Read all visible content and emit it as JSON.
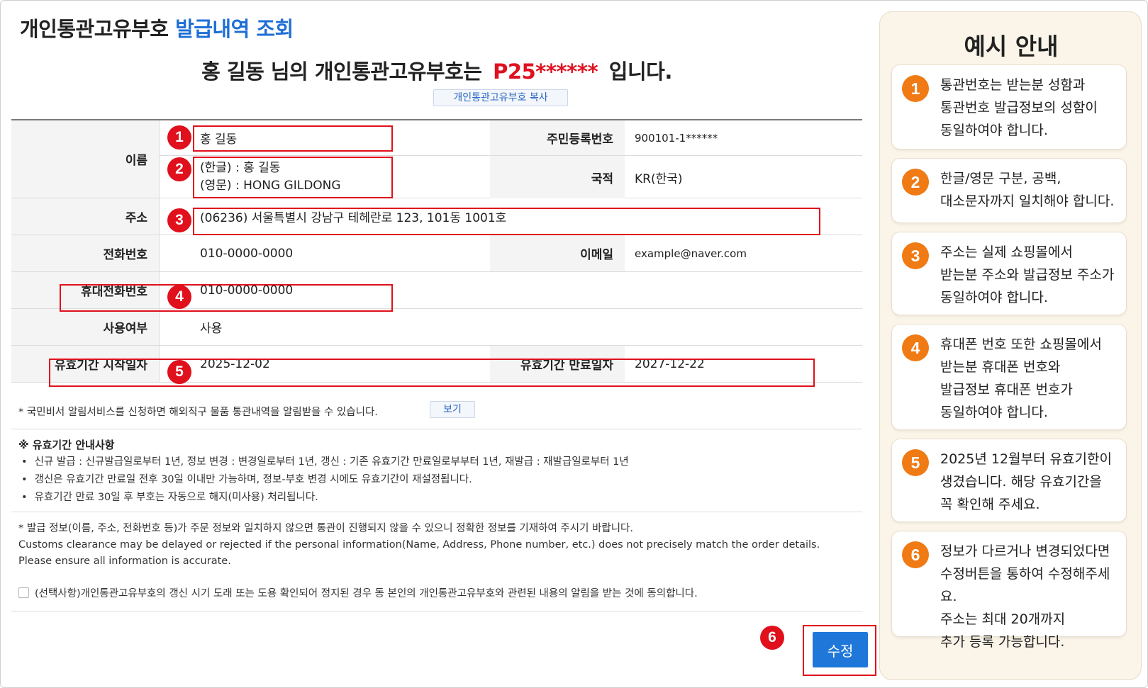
{
  "header": {
    "title_main": "개인통관고유부호",
    "title_accent": "발급내역 조회",
    "headline_prefix": "홍 길동 님의 개인통관고유부호는",
    "headline_number": "P25******",
    "headline_suffix": "입니다.",
    "copy_button": "개인통관고유부호 복사"
  },
  "table": {
    "name_label": "이름",
    "name_value": "홍 길동",
    "name_kr": "(한글) : 홍 길동",
    "name_en": "(영문) : HONG GILDONG",
    "rrn_label": "주민등록번호",
    "rrn_value": "900101-1******",
    "nationality_label": "국적",
    "nationality_value": "KR(한국)",
    "address_label": "주소",
    "address_value": "(06236) 서울특별시 강남구 테헤란로 123, 101동 1001호",
    "phone_label": "전화번호",
    "phone_value": "010-0000-0000",
    "email_label": "이메일",
    "email_value": "example@naver.com",
    "mobile_label": "휴대전화번호",
    "mobile_value": "010-0000-0000",
    "usage_label": "사용여부",
    "usage_value": "사용",
    "start_label": "유효기간 시작일자",
    "start_value": "2025-12-02",
    "end_label": "유효기간 만료일자",
    "end_value": "2027-12-22"
  },
  "badges": [
    "1",
    "2",
    "3",
    "4",
    "5",
    "6"
  ],
  "notice": {
    "alert_text": "* 국민비서 알림서비스를 신청하면 해외직구 물품 통관내역을 알림받을 수 있습니다.",
    "view_button": "보기",
    "guide_title": "※ 유효기간 안내사항",
    "guide_items": [
      "신규 발급 : 신규발급일로부터 1년, 정보 변경 : 변경일로부터 1년, 갱신 : 기존 유효기간 만료일로부부터 1년, 재발급 : 재발급일로부터 1년",
      "갱신은 유효기간 만료일 전후 30일 이내만 가능하며, 정보-부호 변경 시에도 유효기간이 재설정됩니다.",
      "유효기간 만료 30일 후 부호는 자동으로 해지(미사용) 처리됩니다."
    ],
    "warn_kr": "* 발급 정보(이름, 주소, 전화번호 등)가 주문 정보와 일치하지 않으면 통관이 진행되지 않을 수 있으니 정확한 정보를 기재하여 주시기 바랍니다.",
    "warn_en1": "Customs clearance may be delayed or rejected if the personal information(Name, Address, Phone number, etc.) does not precisely match the order details.",
    "warn_en2": "Please ensure all information is accurate.",
    "consent_text": "(선택사항)개인통관고유부호의 갱신 시기 도래 또는 도용 확인되어 정지된 경우 동 본인의 개인통관고유부호와 관련된 내용의 알림을 받는 것에 동의합니다.",
    "edit_button": "수정"
  },
  "guide_panel": {
    "title": "예시 안내",
    "cards": [
      {
        "num": "1",
        "lines": [
          "통관번호는 받는분 성함과",
          "통관번호 발급정보의 성함이",
          "동일하여야 합니다."
        ]
      },
      {
        "num": "2",
        "lines": [
          "한글/영문 구분, 공백,",
          "대소문자까지 일치해야 합니다."
        ]
      },
      {
        "num": "3",
        "lines": [
          "주소는 실제 쇼핑몰에서",
          "받는분 주소와 발급정보 주소가",
          "동일하여야 합니다."
        ]
      },
      {
        "num": "4",
        "lines": [
          "휴대폰 번호 또한 쇼핑몰에서",
          "받는분 휴대폰 번호와",
          "발급정보 휴대폰 번호가",
          "동일하여야 합니다."
        ]
      },
      {
        "num": "5",
        "lines": [
          "2025년 12월부터 유효기한이",
          "생겼습니다. 해당 유효기간을",
          "꼭 확인해 주세요."
        ]
      },
      {
        "num": "6",
        "lines": [
          "정보가 다르거나 변경되었다면",
          "수정버튼을 통하여 수정해주세요.",
          "주소는 최대 20개까지",
          "추가 등록 가능합니다."
        ]
      }
    ]
  },
  "colors": {
    "accent_blue": "#1f6fd6",
    "highlight_red": "#e0101c",
    "guide_orange": "#f07a14",
    "panel_bg": "#faf4e9"
  }
}
